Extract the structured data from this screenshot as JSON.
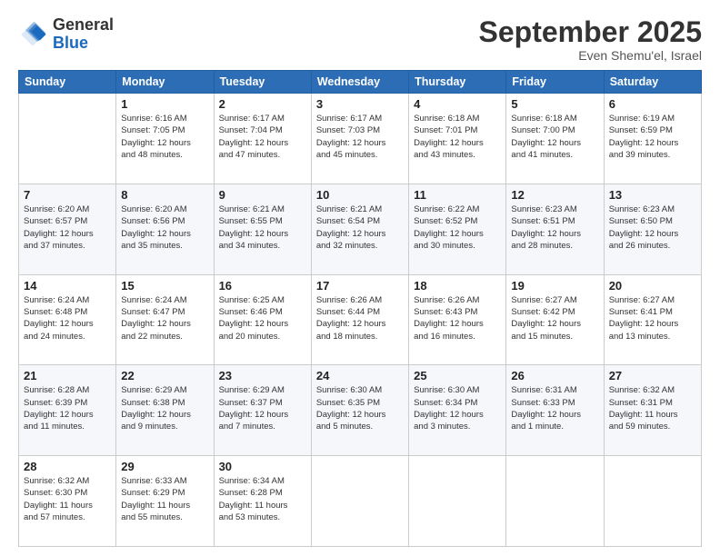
{
  "logo": {
    "general": "General",
    "blue": "Blue"
  },
  "header": {
    "month": "September 2025",
    "location": "Even Shemu'el, Israel"
  },
  "weekdays": [
    "Sunday",
    "Monday",
    "Tuesday",
    "Wednesday",
    "Thursday",
    "Friday",
    "Saturday"
  ],
  "weeks": [
    [
      {
        "day": "",
        "info": ""
      },
      {
        "day": "1",
        "info": "Sunrise: 6:16 AM\nSunset: 7:05 PM\nDaylight: 12 hours\nand 48 minutes."
      },
      {
        "day": "2",
        "info": "Sunrise: 6:17 AM\nSunset: 7:04 PM\nDaylight: 12 hours\nand 47 minutes."
      },
      {
        "day": "3",
        "info": "Sunrise: 6:17 AM\nSunset: 7:03 PM\nDaylight: 12 hours\nand 45 minutes."
      },
      {
        "day": "4",
        "info": "Sunrise: 6:18 AM\nSunset: 7:01 PM\nDaylight: 12 hours\nand 43 minutes."
      },
      {
        "day": "5",
        "info": "Sunrise: 6:18 AM\nSunset: 7:00 PM\nDaylight: 12 hours\nand 41 minutes."
      },
      {
        "day": "6",
        "info": "Sunrise: 6:19 AM\nSunset: 6:59 PM\nDaylight: 12 hours\nand 39 minutes."
      }
    ],
    [
      {
        "day": "7",
        "info": "Sunrise: 6:20 AM\nSunset: 6:57 PM\nDaylight: 12 hours\nand 37 minutes."
      },
      {
        "day": "8",
        "info": "Sunrise: 6:20 AM\nSunset: 6:56 PM\nDaylight: 12 hours\nand 35 minutes."
      },
      {
        "day": "9",
        "info": "Sunrise: 6:21 AM\nSunset: 6:55 PM\nDaylight: 12 hours\nand 34 minutes."
      },
      {
        "day": "10",
        "info": "Sunrise: 6:21 AM\nSunset: 6:54 PM\nDaylight: 12 hours\nand 32 minutes."
      },
      {
        "day": "11",
        "info": "Sunrise: 6:22 AM\nSunset: 6:52 PM\nDaylight: 12 hours\nand 30 minutes."
      },
      {
        "day": "12",
        "info": "Sunrise: 6:23 AM\nSunset: 6:51 PM\nDaylight: 12 hours\nand 28 minutes."
      },
      {
        "day": "13",
        "info": "Sunrise: 6:23 AM\nSunset: 6:50 PM\nDaylight: 12 hours\nand 26 minutes."
      }
    ],
    [
      {
        "day": "14",
        "info": "Sunrise: 6:24 AM\nSunset: 6:48 PM\nDaylight: 12 hours\nand 24 minutes."
      },
      {
        "day": "15",
        "info": "Sunrise: 6:24 AM\nSunset: 6:47 PM\nDaylight: 12 hours\nand 22 minutes."
      },
      {
        "day": "16",
        "info": "Sunrise: 6:25 AM\nSunset: 6:46 PM\nDaylight: 12 hours\nand 20 minutes."
      },
      {
        "day": "17",
        "info": "Sunrise: 6:26 AM\nSunset: 6:44 PM\nDaylight: 12 hours\nand 18 minutes."
      },
      {
        "day": "18",
        "info": "Sunrise: 6:26 AM\nSunset: 6:43 PM\nDaylight: 12 hours\nand 16 minutes."
      },
      {
        "day": "19",
        "info": "Sunrise: 6:27 AM\nSunset: 6:42 PM\nDaylight: 12 hours\nand 15 minutes."
      },
      {
        "day": "20",
        "info": "Sunrise: 6:27 AM\nSunset: 6:41 PM\nDaylight: 12 hours\nand 13 minutes."
      }
    ],
    [
      {
        "day": "21",
        "info": "Sunrise: 6:28 AM\nSunset: 6:39 PM\nDaylight: 12 hours\nand 11 minutes."
      },
      {
        "day": "22",
        "info": "Sunrise: 6:29 AM\nSunset: 6:38 PM\nDaylight: 12 hours\nand 9 minutes."
      },
      {
        "day": "23",
        "info": "Sunrise: 6:29 AM\nSunset: 6:37 PM\nDaylight: 12 hours\nand 7 minutes."
      },
      {
        "day": "24",
        "info": "Sunrise: 6:30 AM\nSunset: 6:35 PM\nDaylight: 12 hours\nand 5 minutes."
      },
      {
        "day": "25",
        "info": "Sunrise: 6:30 AM\nSunset: 6:34 PM\nDaylight: 12 hours\nand 3 minutes."
      },
      {
        "day": "26",
        "info": "Sunrise: 6:31 AM\nSunset: 6:33 PM\nDaylight: 12 hours\nand 1 minute."
      },
      {
        "day": "27",
        "info": "Sunrise: 6:32 AM\nSunset: 6:31 PM\nDaylight: 11 hours\nand 59 minutes."
      }
    ],
    [
      {
        "day": "28",
        "info": "Sunrise: 6:32 AM\nSunset: 6:30 PM\nDaylight: 11 hours\nand 57 minutes."
      },
      {
        "day": "29",
        "info": "Sunrise: 6:33 AM\nSunset: 6:29 PM\nDaylight: 11 hours\nand 55 minutes."
      },
      {
        "day": "30",
        "info": "Sunrise: 6:34 AM\nSunset: 6:28 PM\nDaylight: 11 hours\nand 53 minutes."
      },
      {
        "day": "",
        "info": ""
      },
      {
        "day": "",
        "info": ""
      },
      {
        "day": "",
        "info": ""
      },
      {
        "day": "",
        "info": ""
      }
    ]
  ]
}
